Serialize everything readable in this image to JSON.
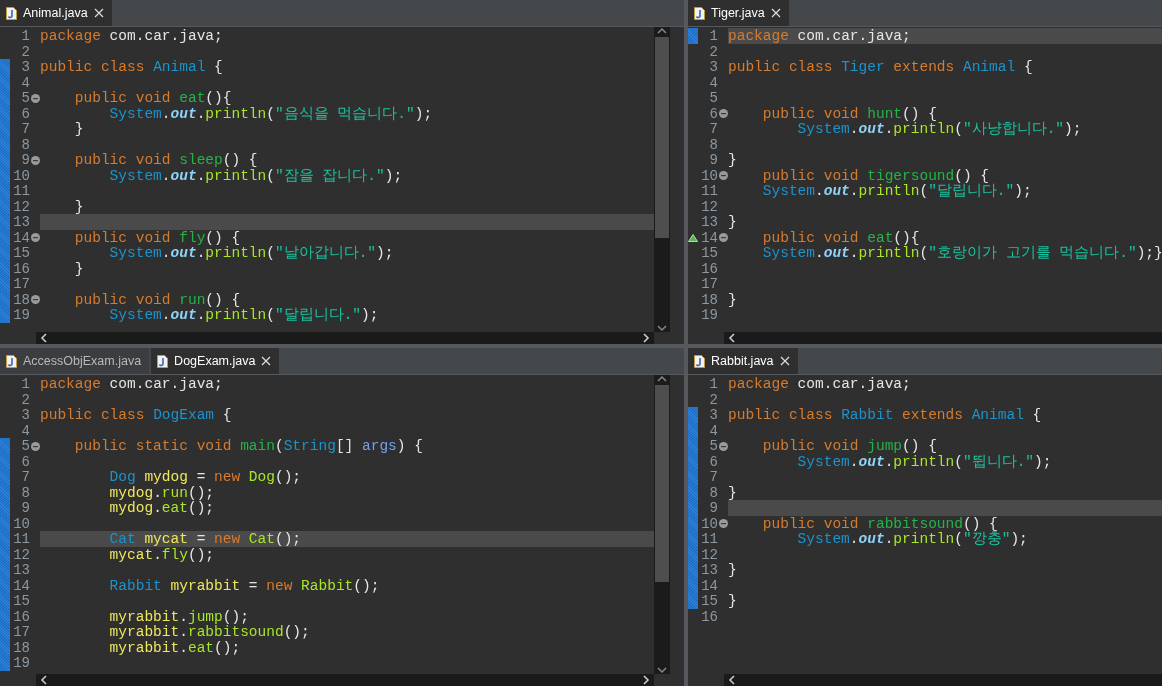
{
  "editors": [
    {
      "tabs": [
        {
          "label": "Animal.java",
          "selected": true
        }
      ],
      "vertical_scrollbar": true,
      "lines": [
        {
          "number": "1",
          "changed": false,
          "current": false,
          "fold": false,
          "override": false,
          "tokens": [
            {
              "kind": "kw",
              "text": "package"
            },
            {
              "kind": "plain",
              "text": " com.car.java;"
            }
          ]
        },
        {
          "number": "2",
          "changed": false,
          "current": false,
          "fold": false,
          "override": false
        },
        {
          "number": "3",
          "changed": true,
          "current": false,
          "fold": false,
          "override": false,
          "tokens": [
            {
              "kind": "kw",
              "text": "public class "
            },
            {
              "kind": "type",
              "text": "Animal"
            },
            {
              "kind": "plain",
              "text": " {"
            }
          ]
        },
        {
          "number": "4",
          "changed": true,
          "current": false,
          "fold": false,
          "override": false
        },
        {
          "number": "5",
          "changed": true,
          "current": false,
          "fold": true,
          "override": false,
          "tokens": [
            {
              "kind": "kw",
              "text": "    public void "
            },
            {
              "kind": "method",
              "text": "eat"
            },
            {
              "kind": "plain",
              "text": "(){"
            }
          ]
        },
        {
          "number": "6",
          "changed": true,
          "current": false,
          "fold": false,
          "override": false,
          "tokens": [
            {
              "kind": "type",
              "text": "        System"
            },
            {
              "kind": "plain",
              "text": "."
            },
            {
              "kind": "field",
              "text": "out"
            },
            {
              "kind": "plain",
              "text": "."
            },
            {
              "kind": "call",
              "text": "println"
            },
            {
              "kind": "plain",
              "text": "("
            },
            {
              "kind": "string",
              "text": "\"음식을 먹습니다.\""
            },
            {
              "kind": "plain",
              "text": ");"
            }
          ]
        },
        {
          "number": "7",
          "changed": true,
          "current": false,
          "fold": false,
          "override": false,
          "tokens": [
            {
              "kind": "plain",
              "text": "    }"
            }
          ]
        },
        {
          "number": "8",
          "changed": true,
          "current": false,
          "fold": false,
          "override": false
        },
        {
          "number": "9",
          "changed": true,
          "current": false,
          "fold": true,
          "override": false,
          "tokens": [
            {
              "kind": "kw",
              "text": "    public void "
            },
            {
              "kind": "method",
              "text": "sleep"
            },
            {
              "kind": "plain",
              "text": "() {"
            }
          ]
        },
        {
          "number": "10",
          "changed": true,
          "current": false,
          "fold": false,
          "override": false,
          "tokens": [
            {
              "kind": "type",
              "text": "        System"
            },
            {
              "kind": "plain",
              "text": "."
            },
            {
              "kind": "field",
              "text": "out"
            },
            {
              "kind": "plain",
              "text": "."
            },
            {
              "kind": "call",
              "text": "println"
            },
            {
              "kind": "plain",
              "text": "("
            },
            {
              "kind": "string",
              "text": "\"잠을 잡니다.\""
            },
            {
              "kind": "plain",
              "text": ");"
            }
          ]
        },
        {
          "number": "11",
          "changed": true,
          "current": false,
          "fold": false,
          "override": false
        },
        {
          "number": "12",
          "changed": true,
          "current": false,
          "fold": false,
          "override": false,
          "tokens": [
            {
              "kind": "plain",
              "text": "    }"
            }
          ]
        },
        {
          "number": "13",
          "changed": true,
          "current": true,
          "fold": false,
          "override": false
        },
        {
          "number": "14",
          "changed": true,
          "current": false,
          "fold": true,
          "override": false,
          "tokens": [
            {
              "kind": "kw",
              "text": "    public void "
            },
            {
              "kind": "method",
              "text": "fly"
            },
            {
              "kind": "plain",
              "text": "() {"
            }
          ]
        },
        {
          "number": "15",
          "changed": true,
          "current": false,
          "fold": false,
          "override": false,
          "tokens": [
            {
              "kind": "type",
              "text": "        System"
            },
            {
              "kind": "plain",
              "text": "."
            },
            {
              "kind": "field",
              "text": "out"
            },
            {
              "kind": "plain",
              "text": "."
            },
            {
              "kind": "call",
              "text": "println"
            },
            {
              "kind": "plain",
              "text": "("
            },
            {
              "kind": "string",
              "text": "\"날아갑니다.\""
            },
            {
              "kind": "plain",
              "text": ");"
            }
          ]
        },
        {
          "number": "16",
          "changed": true,
          "current": false,
          "fold": false,
          "override": false,
          "tokens": [
            {
              "kind": "plain",
              "text": "    }"
            }
          ]
        },
        {
          "number": "17",
          "changed": true,
          "current": false,
          "fold": false,
          "override": false
        },
        {
          "number": "18",
          "changed": true,
          "current": false,
          "fold": true,
          "override": false,
          "tokens": [
            {
              "kind": "kw",
              "text": "    public void "
            },
            {
              "kind": "method",
              "text": "run"
            },
            {
              "kind": "plain",
              "text": "() {"
            }
          ]
        },
        {
          "number": "19",
          "changed": true,
          "current": false,
          "fold": false,
          "override": false,
          "tokens": [
            {
              "kind": "type",
              "text": "        System"
            },
            {
              "kind": "plain",
              "text": "."
            },
            {
              "kind": "field",
              "text": "out"
            },
            {
              "kind": "plain",
              "text": "."
            },
            {
              "kind": "call",
              "text": "println"
            },
            {
              "kind": "plain",
              "text": "("
            },
            {
              "kind": "string",
              "text": "\"달립니다.\""
            },
            {
              "kind": "plain",
              "text": ");"
            }
          ]
        }
      ]
    },
    {
      "tabs": [
        {
          "label": "Tiger.java",
          "selected": true
        }
      ],
      "vertical_scrollbar": false,
      "lines": [
        {
          "number": "1",
          "changed": true,
          "current": true,
          "fold": false,
          "override": false,
          "tokens": [
            {
              "kind": "kw",
              "text": "package"
            },
            {
              "kind": "plain",
              "text": " com.car.java;"
            }
          ]
        },
        {
          "number": "2",
          "changed": false,
          "current": false,
          "fold": false,
          "override": false
        },
        {
          "number": "3",
          "changed": false,
          "current": false,
          "fold": false,
          "override": false,
          "tokens": [
            {
              "kind": "kw",
              "text": "public class "
            },
            {
              "kind": "type",
              "text": "Tiger"
            },
            {
              "kind": "kw",
              "text": " extends "
            },
            {
              "kind": "type",
              "text": "Animal"
            },
            {
              "kind": "plain",
              "text": " {"
            }
          ]
        },
        {
          "number": "4",
          "changed": false,
          "current": false,
          "fold": false,
          "override": false
        },
        {
          "number": "5",
          "changed": false,
          "current": false,
          "fold": false,
          "override": false
        },
        {
          "number": "6",
          "changed": false,
          "current": false,
          "fold": true,
          "override": false,
          "tokens": [
            {
              "kind": "kw",
              "text": "    public void "
            },
            {
              "kind": "method",
              "text": "hunt"
            },
            {
              "kind": "plain",
              "text": "() {"
            }
          ]
        },
        {
          "number": "7",
          "changed": false,
          "current": false,
          "fold": false,
          "override": false,
          "tokens": [
            {
              "kind": "type",
              "text": "        System"
            },
            {
              "kind": "plain",
              "text": "."
            },
            {
              "kind": "field",
              "text": "out"
            },
            {
              "kind": "plain",
              "text": "."
            },
            {
              "kind": "call",
              "text": "println"
            },
            {
              "kind": "plain",
              "text": "("
            },
            {
              "kind": "string",
              "text": "\"사냥합니다.\""
            },
            {
              "kind": "plain",
              "text": ");"
            }
          ]
        },
        {
          "number": "8",
          "changed": false,
          "current": false,
          "fold": false,
          "override": false
        },
        {
          "number": "9",
          "changed": false,
          "current": false,
          "fold": false,
          "override": false,
          "tokens": [
            {
              "kind": "plain",
              "text": "}"
            }
          ]
        },
        {
          "number": "10",
          "changed": false,
          "current": false,
          "fold": true,
          "override": false,
          "tokens": [
            {
              "kind": "kw",
              "text": "    public void "
            },
            {
              "kind": "method",
              "text": "tigersound"
            },
            {
              "kind": "plain",
              "text": "() {"
            }
          ]
        },
        {
          "number": "11",
          "changed": false,
          "current": false,
          "fold": false,
          "override": false,
          "tokens": [
            {
              "kind": "type",
              "text": "    System"
            },
            {
              "kind": "plain",
              "text": "."
            },
            {
              "kind": "field",
              "text": "out"
            },
            {
              "kind": "plain",
              "text": "."
            },
            {
              "kind": "call",
              "text": "println"
            },
            {
              "kind": "plain",
              "text": "("
            },
            {
              "kind": "string",
              "text": "\"달립니다.\""
            },
            {
              "kind": "plain",
              "text": ");"
            }
          ]
        },
        {
          "number": "12",
          "changed": false,
          "current": false,
          "fold": false,
          "override": false
        },
        {
          "number": "13",
          "changed": false,
          "current": false,
          "fold": false,
          "override": false,
          "tokens": [
            {
              "kind": "plain",
              "text": "}"
            }
          ]
        },
        {
          "number": "14",
          "changed": false,
          "current": false,
          "fold": true,
          "override": true,
          "tokens": [
            {
              "kind": "kw",
              "text": "    public void "
            },
            {
              "kind": "method",
              "text": "eat"
            },
            {
              "kind": "plain",
              "text": "(){"
            }
          ]
        },
        {
          "number": "15",
          "changed": false,
          "current": false,
          "fold": false,
          "override": false,
          "tokens": [
            {
              "kind": "type",
              "text": "    System"
            },
            {
              "kind": "plain",
              "text": "."
            },
            {
              "kind": "field",
              "text": "out"
            },
            {
              "kind": "plain",
              "text": "."
            },
            {
              "kind": "call",
              "text": "println"
            },
            {
              "kind": "plain",
              "text": "("
            },
            {
              "kind": "string",
              "text": "\"호랑이가 고기를 먹습니다.\""
            },
            {
              "kind": "plain",
              "text": ");}"
            }
          ]
        },
        {
          "number": "16",
          "changed": false,
          "current": false,
          "fold": false,
          "override": false
        },
        {
          "number": "17",
          "changed": false,
          "current": false,
          "fold": false,
          "override": false
        },
        {
          "number": "18",
          "changed": false,
          "current": false,
          "fold": false,
          "override": false,
          "tokens": [
            {
              "kind": "plain",
              "text": "}"
            }
          ]
        },
        {
          "number": "19",
          "changed": false,
          "current": false,
          "fold": false,
          "override": false
        }
      ]
    },
    {
      "tabs": [
        {
          "label": "AccessObjExam.java",
          "selected": false
        },
        {
          "label": "DogExam.java",
          "selected": true
        }
      ],
      "vertical_scrollbar": true,
      "lines": [
        {
          "number": "1",
          "changed": false,
          "current": false,
          "fold": false,
          "override": false,
          "tokens": [
            {
              "kind": "kw",
              "text": "package"
            },
            {
              "kind": "plain",
              "text": " com.car.java;"
            }
          ]
        },
        {
          "number": "2",
          "changed": false,
          "current": false,
          "fold": false,
          "override": false
        },
        {
          "number": "3",
          "changed": false,
          "current": false,
          "fold": false,
          "override": false,
          "tokens": [
            {
              "kind": "kw",
              "text": "public class "
            },
            {
              "kind": "type",
              "text": "DogExam"
            },
            {
              "kind": "plain",
              "text": " {"
            }
          ]
        },
        {
          "number": "4",
          "changed": false,
          "current": false,
          "fold": false,
          "override": false
        },
        {
          "number": "5",
          "changed": true,
          "current": false,
          "fold": true,
          "override": false,
          "tokens": [
            {
              "kind": "kw",
              "text": "    public static void "
            },
            {
              "kind": "method",
              "text": "main"
            },
            {
              "kind": "plain",
              "text": "("
            },
            {
              "kind": "type",
              "text": "String"
            },
            {
              "kind": "plain",
              "text": "[] "
            },
            {
              "kind": "param",
              "text": "args"
            },
            {
              "kind": "plain",
              "text": ") {"
            }
          ]
        },
        {
          "number": "6",
          "changed": true,
          "current": false,
          "fold": false,
          "override": false
        },
        {
          "number": "7",
          "changed": true,
          "current": false,
          "fold": false,
          "override": false,
          "tokens": [
            {
              "kind": "type",
              "text": "        Dog "
            },
            {
              "kind": "local",
              "text": "mydog"
            },
            {
              "kind": "plain",
              "text": " = "
            },
            {
              "kind": "kw",
              "text": "new "
            },
            {
              "kind": "call",
              "text": "Dog"
            },
            {
              "kind": "plain",
              "text": "();"
            }
          ]
        },
        {
          "number": "8",
          "changed": true,
          "current": false,
          "fold": false,
          "override": false,
          "tokens": [
            {
              "kind": "local",
              "text": "        mydog"
            },
            {
              "kind": "plain",
              "text": "."
            },
            {
              "kind": "call",
              "text": "run"
            },
            {
              "kind": "plain",
              "text": "();"
            }
          ]
        },
        {
          "number": "9",
          "changed": true,
          "current": false,
          "fold": false,
          "override": false,
          "tokens": [
            {
              "kind": "local",
              "text": "        mydog"
            },
            {
              "kind": "plain",
              "text": "."
            },
            {
              "kind": "call",
              "text": "eat"
            },
            {
              "kind": "plain",
              "text": "();"
            }
          ]
        },
        {
          "number": "10",
          "changed": true,
          "current": false,
          "fold": false,
          "override": false
        },
        {
          "number": "11",
          "changed": true,
          "current": true,
          "fold": false,
          "override": false,
          "tokens": [
            {
              "kind": "type",
              "text": "        Cat "
            },
            {
              "kind": "local",
              "text": "mycat"
            },
            {
              "kind": "plain",
              "text": " = "
            },
            {
              "kind": "kw",
              "text": "new "
            },
            {
              "kind": "call",
              "text": "Cat"
            },
            {
              "kind": "plain",
              "text": "();"
            }
          ]
        },
        {
          "number": "12",
          "changed": true,
          "current": false,
          "fold": false,
          "override": false,
          "tokens": [
            {
              "kind": "local",
              "text": "        mycat"
            },
            {
              "kind": "plain",
              "text": "."
            },
            {
              "kind": "call",
              "text": "fly"
            },
            {
              "kind": "plain",
              "text": "();"
            }
          ]
        },
        {
          "number": "13",
          "changed": true,
          "current": false,
          "fold": false,
          "override": false
        },
        {
          "number": "14",
          "changed": true,
          "current": false,
          "fold": false,
          "override": false,
          "tokens": [
            {
              "kind": "type",
              "text": "        Rabbit "
            },
            {
              "kind": "local",
              "text": "myrabbit"
            },
            {
              "kind": "plain",
              "text": " = "
            },
            {
              "kind": "kw",
              "text": "new "
            },
            {
              "kind": "call",
              "text": "Rabbit"
            },
            {
              "kind": "plain",
              "text": "();"
            }
          ]
        },
        {
          "number": "15",
          "changed": true,
          "current": false,
          "fold": false,
          "override": false
        },
        {
          "number": "16",
          "changed": true,
          "current": false,
          "fold": false,
          "override": false,
          "tokens": [
            {
              "kind": "local",
              "text": "        myrabbit"
            },
            {
              "kind": "plain",
              "text": "."
            },
            {
              "kind": "call",
              "text": "jump"
            },
            {
              "kind": "plain",
              "text": "();"
            }
          ]
        },
        {
          "number": "17",
          "changed": true,
          "current": false,
          "fold": false,
          "override": false,
          "tokens": [
            {
              "kind": "local",
              "text": "        myrabbit"
            },
            {
              "kind": "plain",
              "text": "."
            },
            {
              "kind": "call",
              "text": "rabbitsound"
            },
            {
              "kind": "plain",
              "text": "();"
            }
          ]
        },
        {
          "number": "18",
          "changed": true,
          "current": false,
          "fold": false,
          "override": false,
          "tokens": [
            {
              "kind": "local",
              "text": "        myrabbit"
            },
            {
              "kind": "plain",
              "text": "."
            },
            {
              "kind": "call",
              "text": "eat"
            },
            {
              "kind": "plain",
              "text": "();"
            }
          ]
        },
        {
          "number": "19",
          "changed": true,
          "current": false,
          "fold": false,
          "override": false
        }
      ]
    },
    {
      "tabs": [
        {
          "label": "Rabbit.java",
          "selected": true
        }
      ],
      "vertical_scrollbar": false,
      "lines": [
        {
          "number": "1",
          "changed": false,
          "current": false,
          "fold": false,
          "override": false,
          "tokens": [
            {
              "kind": "kw",
              "text": "package"
            },
            {
              "kind": "plain",
              "text": " com.car.java;"
            }
          ]
        },
        {
          "number": "2",
          "changed": false,
          "current": false,
          "fold": false,
          "override": false
        },
        {
          "number": "3",
          "changed": true,
          "current": false,
          "fold": false,
          "override": false,
          "tokens": [
            {
              "kind": "kw",
              "text": "public class "
            },
            {
              "kind": "type",
              "text": "Rabbit"
            },
            {
              "kind": "kw",
              "text": " extends "
            },
            {
              "kind": "type",
              "text": "Animal"
            },
            {
              "kind": "plain",
              "text": " {"
            }
          ]
        },
        {
          "number": "4",
          "changed": true,
          "current": false,
          "fold": false,
          "override": false
        },
        {
          "number": "5",
          "changed": true,
          "current": false,
          "fold": true,
          "override": false,
          "tokens": [
            {
              "kind": "kw",
              "text": "    public void "
            },
            {
              "kind": "method",
              "text": "jump"
            },
            {
              "kind": "plain",
              "text": "() {"
            }
          ]
        },
        {
          "number": "6",
          "changed": true,
          "current": false,
          "fold": false,
          "override": false,
          "tokens": [
            {
              "kind": "type",
              "text": "        System"
            },
            {
              "kind": "plain",
              "text": "."
            },
            {
              "kind": "field",
              "text": "out"
            },
            {
              "kind": "plain",
              "text": "."
            },
            {
              "kind": "call",
              "text": "println"
            },
            {
              "kind": "plain",
              "text": "("
            },
            {
              "kind": "string",
              "text": "\"뜁니다.\""
            },
            {
              "kind": "plain",
              "text": ");"
            }
          ]
        },
        {
          "number": "7",
          "changed": true,
          "current": false,
          "fold": false,
          "override": false
        },
        {
          "number": "8",
          "changed": true,
          "current": false,
          "fold": false,
          "override": false,
          "tokens": [
            {
              "kind": "plain",
              "text": "}"
            }
          ]
        },
        {
          "number": "9",
          "changed": true,
          "current": true,
          "fold": false,
          "override": false
        },
        {
          "number": "10",
          "changed": true,
          "current": false,
          "fold": true,
          "override": false,
          "tokens": [
            {
              "kind": "kw",
              "text": "    public void "
            },
            {
              "kind": "method",
              "text": "rabbitsound"
            },
            {
              "kind": "plain",
              "text": "() {"
            }
          ]
        },
        {
          "number": "11",
          "changed": true,
          "current": false,
          "fold": false,
          "override": false,
          "tokens": [
            {
              "kind": "type",
              "text": "        System"
            },
            {
              "kind": "plain",
              "text": "."
            },
            {
              "kind": "field",
              "text": "out"
            },
            {
              "kind": "plain",
              "text": "."
            },
            {
              "kind": "call",
              "text": "println"
            },
            {
              "kind": "plain",
              "text": "("
            },
            {
              "kind": "string",
              "text": "\"깡충\""
            },
            {
              "kind": "plain",
              "text": ");"
            }
          ]
        },
        {
          "number": "12",
          "changed": true,
          "current": false,
          "fold": false,
          "override": false
        },
        {
          "number": "13",
          "changed": true,
          "current": false,
          "fold": false,
          "override": false,
          "tokens": [
            {
              "kind": "plain",
              "text": "}"
            }
          ]
        },
        {
          "number": "14",
          "changed": true,
          "current": false,
          "fold": false,
          "override": false
        },
        {
          "number": "15",
          "changed": true,
          "current": false,
          "fold": false,
          "override": false,
          "tokens": [
            {
              "kind": "plain",
              "text": "}"
            }
          ]
        },
        {
          "number": "16",
          "changed": false,
          "current": false,
          "fold": false,
          "override": false
        }
      ]
    }
  ]
}
